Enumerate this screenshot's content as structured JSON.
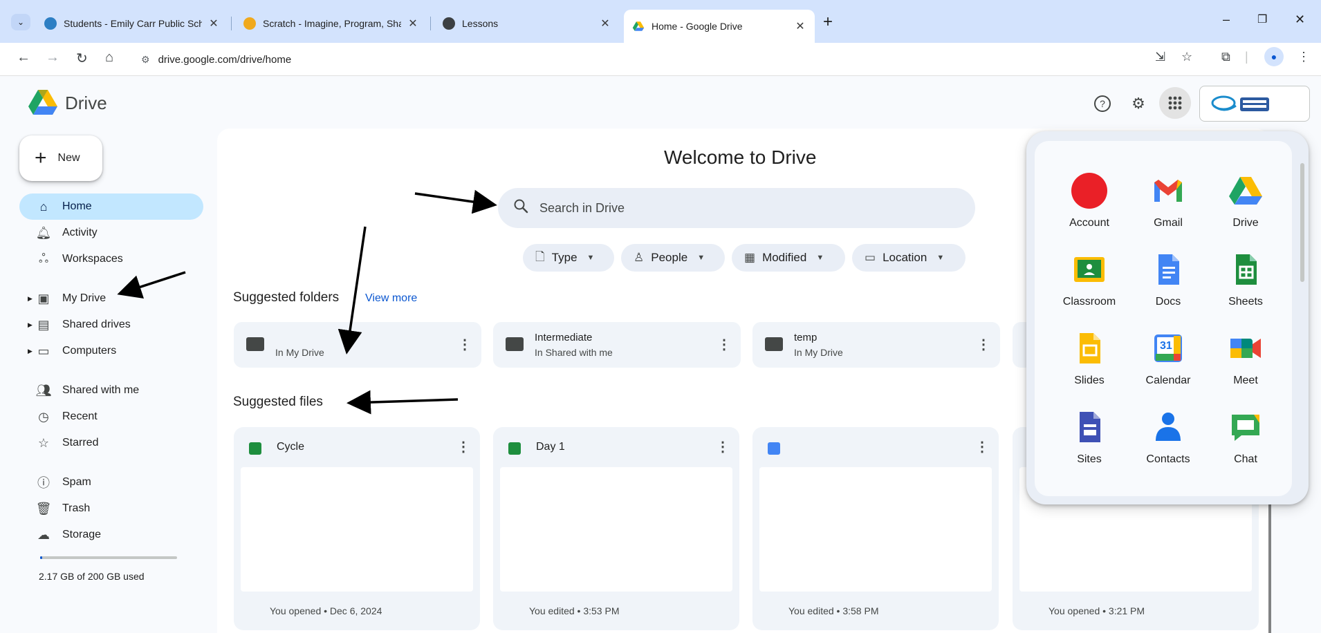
{
  "browser": {
    "tabs": [
      {
        "title": "Students - Emily Carr Public Sch",
        "icon": "emily-carr-favicon",
        "color": "#2d7fc4"
      },
      {
        "title": "Scratch - Imagine, Program, Sha",
        "icon": "scratch-favicon",
        "color": "#f0a91d"
      },
      {
        "title": "Lessons",
        "icon": "globe-icon",
        "color": "#3c4043"
      },
      {
        "title": "Home - Google Drive",
        "icon": "google-drive-favicon",
        "color": "#1fa463"
      }
    ],
    "new_tab": "+",
    "tab_close": "✕",
    "url": "drive.google.com/drive/home"
  },
  "drive": {
    "title": "Drive",
    "welcome": "Welcome to Drive",
    "new_label": "New",
    "search_placeholder": "Search in Drive",
    "filters": [
      "Type",
      "People",
      "Modified",
      "Location"
    ],
    "sidebar": {
      "items": [
        {
          "label": "Home",
          "icon": "home-icon"
        },
        {
          "label": "Activity",
          "icon": "bell-icon"
        },
        {
          "label": "Workspaces",
          "icon": "workspaces-icon"
        },
        {
          "label": "My Drive",
          "icon": "my-drive-icon"
        },
        {
          "label": "Shared drives",
          "icon": "shared-drives-icon"
        },
        {
          "label": "Computers",
          "icon": "computers-icon"
        },
        {
          "label": "Shared with me",
          "icon": "people-icon"
        },
        {
          "label": "Recent",
          "icon": "clock-icon"
        },
        {
          "label": "Starred",
          "icon": "star-icon"
        },
        {
          "label": "Spam",
          "icon": "spam-icon"
        },
        {
          "label": "Trash",
          "icon": "trash-icon"
        },
        {
          "label": "Storage",
          "icon": "cloud-icon"
        }
      ],
      "storage_text": "2.17 GB of 200 GB used",
      "storage_fraction": 0.011
    },
    "suggested_folders_title": "Suggested folders",
    "view_more": "View more",
    "folders": [
      {
        "name": "",
        "location": "In My Drive",
        "icon": "folder-icon"
      },
      {
        "name": "Intermediate",
        "location": "In Shared with me",
        "icon": "shared-folder-icon"
      },
      {
        "name": "temp",
        "location": "In My Drive",
        "icon": "folder-icon"
      }
    ],
    "suggested_files_title": "Suggested files",
    "files": [
      {
        "name": "Cycle",
        "meta": "You opened • Dec 6, 2024",
        "type": "sheets",
        "color": "#1e8e3e"
      },
      {
        "name": "Day 1",
        "meta": "You edited • 3:53 PM",
        "type": "sheets",
        "color": "#1e8e3e"
      },
      {
        "name": "",
        "meta": "You edited • 3:58 PM",
        "type": "docs",
        "color": "#4285f4"
      },
      {
        "name": "",
        "meta": "You opened • 3:21 PM",
        "type": "unknown",
        "color": "#4285f4"
      }
    ],
    "more_glyph": "⋮"
  },
  "apps": [
    {
      "label": "Account",
      "color": "#ea2027"
    },
    {
      "label": "Gmail",
      "color": "#ea4335"
    },
    {
      "label": "Drive",
      "color": "#1fa463"
    },
    {
      "label": "Classroom",
      "color": "#1e8e3e"
    },
    {
      "label": "Docs",
      "color": "#4285f4"
    },
    {
      "label": "Sheets",
      "color": "#1e8e3e"
    },
    {
      "label": "Slides",
      "color": "#fbbc04"
    },
    {
      "label": "Calendar",
      "color": "#4285f4"
    },
    {
      "label": "Meet",
      "color": "#00897b"
    },
    {
      "label": "Sites",
      "color": "#3f51b5"
    },
    {
      "label": "Contacts",
      "color": "#1a73e8"
    },
    {
      "label": "Chat",
      "color": "#34a853"
    }
  ],
  "calendar_day": "31"
}
